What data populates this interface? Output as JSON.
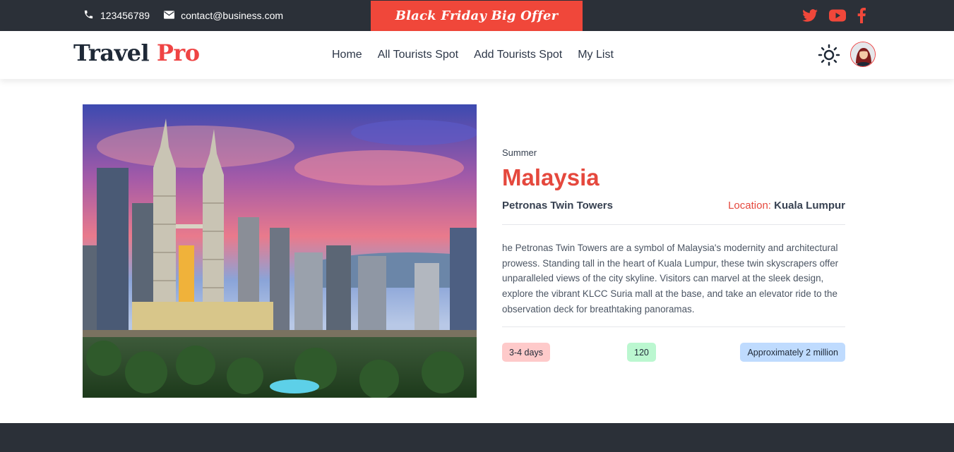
{
  "topbar": {
    "phone": "123456789",
    "email": "contact@business.com",
    "offer": "Black Friday Big Offer",
    "social_icons": [
      "twitter-icon",
      "youtube-icon",
      "facebook-icon"
    ],
    "social_color": "#f0473a"
  },
  "navbar": {
    "logo_part1": "Travel",
    "logo_part2": "Pro",
    "menu": [
      "Home",
      "All Tourists Spot",
      "Add Tourists Spot",
      "My List"
    ]
  },
  "spot": {
    "season": "Summer",
    "country": "Malaysia",
    "name": "Petronas Twin Towers",
    "location_label": "Location:",
    "location": "Kuala Lumpur",
    "description": "he Petronas Twin Towers are a symbol of Malaysia's modernity and architectural prowess. Standing tall in the heart of Kuala Lumpur, these twin skyscrapers offer unparalleled views of the city skyline. Visitors can marvel at the sleek design, explore the vibrant KLCC Suria mall at the base, and take an elevator ride to the observation deck for breathtaking panoramas.",
    "travel_time": "3-4 days",
    "average_cost": "120",
    "visitors": "Approximately 2 million"
  },
  "colors": {
    "accent": "#e5483d",
    "dark": "#2b3038"
  }
}
